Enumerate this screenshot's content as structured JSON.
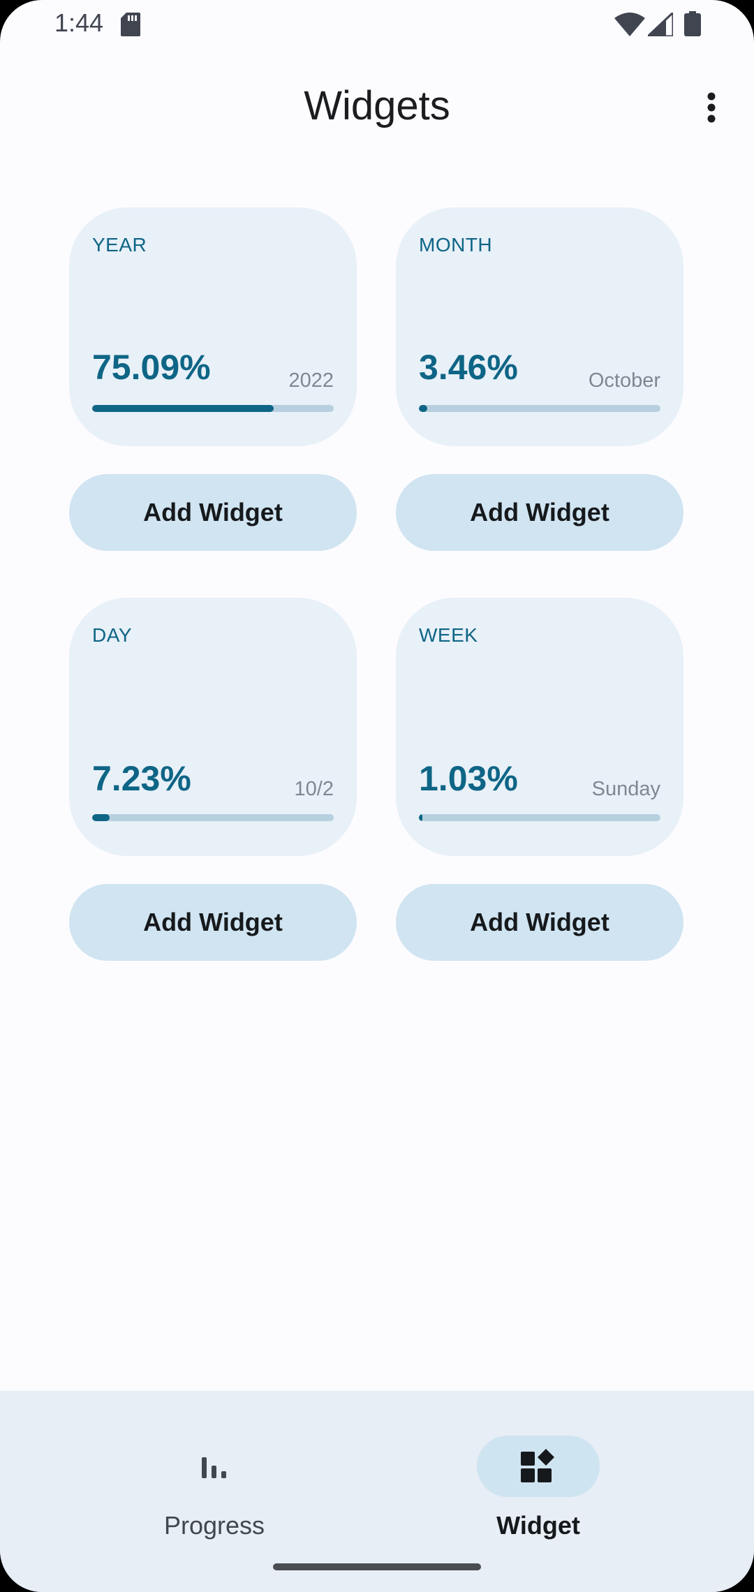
{
  "status_bar": {
    "time": "1:44"
  },
  "app_bar": {
    "title": "Widgets"
  },
  "widgets": [
    {
      "label": "YEAR",
      "percent_text": "75.09%",
      "sub": "2022",
      "progress": 0.7509,
      "button_label": "Add Widget"
    },
    {
      "label": "MONTH",
      "percent_text": "3.46%",
      "sub": "October",
      "progress": 0.0346,
      "button_label": "Add Widget"
    },
    {
      "label": "DAY",
      "percent_text": "7.23%",
      "sub": "10/2",
      "progress": 0.0723,
      "button_label": "Add Widget"
    },
    {
      "label": "WEEK",
      "percent_text": "1.03%",
      "sub": "Sunday",
      "progress": 0.0103,
      "button_label": "Add Widget"
    }
  ],
  "bottom_nav": {
    "items": [
      {
        "label": "Progress",
        "icon": "bar-chart-icon",
        "active": false
      },
      {
        "label": "Widget",
        "icon": "widgets-icon",
        "active": true
      }
    ]
  },
  "colors": {
    "accent": "#0e6585",
    "card_bg": "#e8f0f8",
    "button_bg": "#d0e4f1",
    "track": "#b7d0df"
  }
}
